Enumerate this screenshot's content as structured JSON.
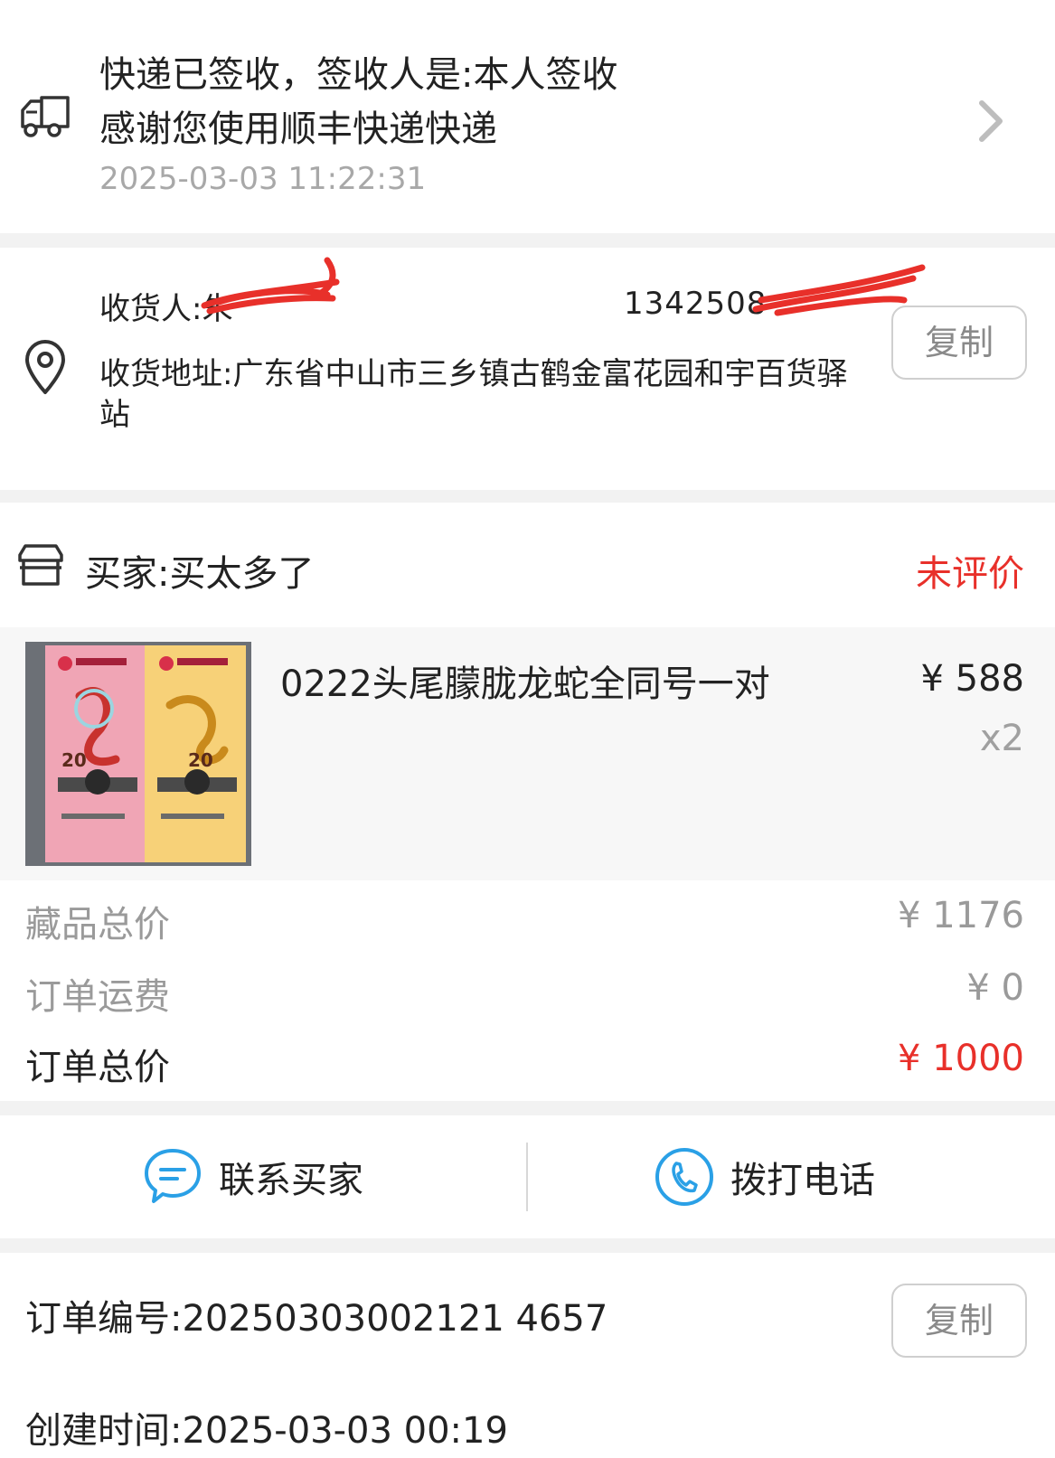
{
  "logistics": {
    "status_line": "快递已签收，签收人是:本人签收",
    "thanks_line": "感谢您使用顺丰快递快递",
    "timestamp": "2025-03-03 11:22:31",
    "icon": "truck-icon"
  },
  "address": {
    "receiver_label": "收货人:朱",
    "phone": "1342508",
    "address_text": "收货地址:广东省中山市三乡镇古鹤金富花园和宇百货驿站",
    "copy_label": "复制"
  },
  "buyer": {
    "label": "买家:买太多了",
    "review_status": "未评价"
  },
  "product": {
    "title": "0222头尾朦胧龙蛇全同号一对",
    "price": "¥ 588",
    "quantity": "x2"
  },
  "totals": {
    "items_label": "藏品总价",
    "items_value": "¥ 1176",
    "shipping_label": "订单运费",
    "shipping_value": "¥ 0",
    "order_total_label": "订单总价",
    "order_total_value": "¥ 1000"
  },
  "actions": {
    "contact_label": "联系买家",
    "call_label": "拨打电话"
  },
  "order": {
    "number": "订单编号:20250303002121 4657",
    "copy_label": "复制",
    "created": "创建时间:2025-03-03 00:19"
  },
  "colors": {
    "accent_red": "#e8302a",
    "icon_blue": "#2aa0e6",
    "muted_gray": "#9a9a9a"
  }
}
